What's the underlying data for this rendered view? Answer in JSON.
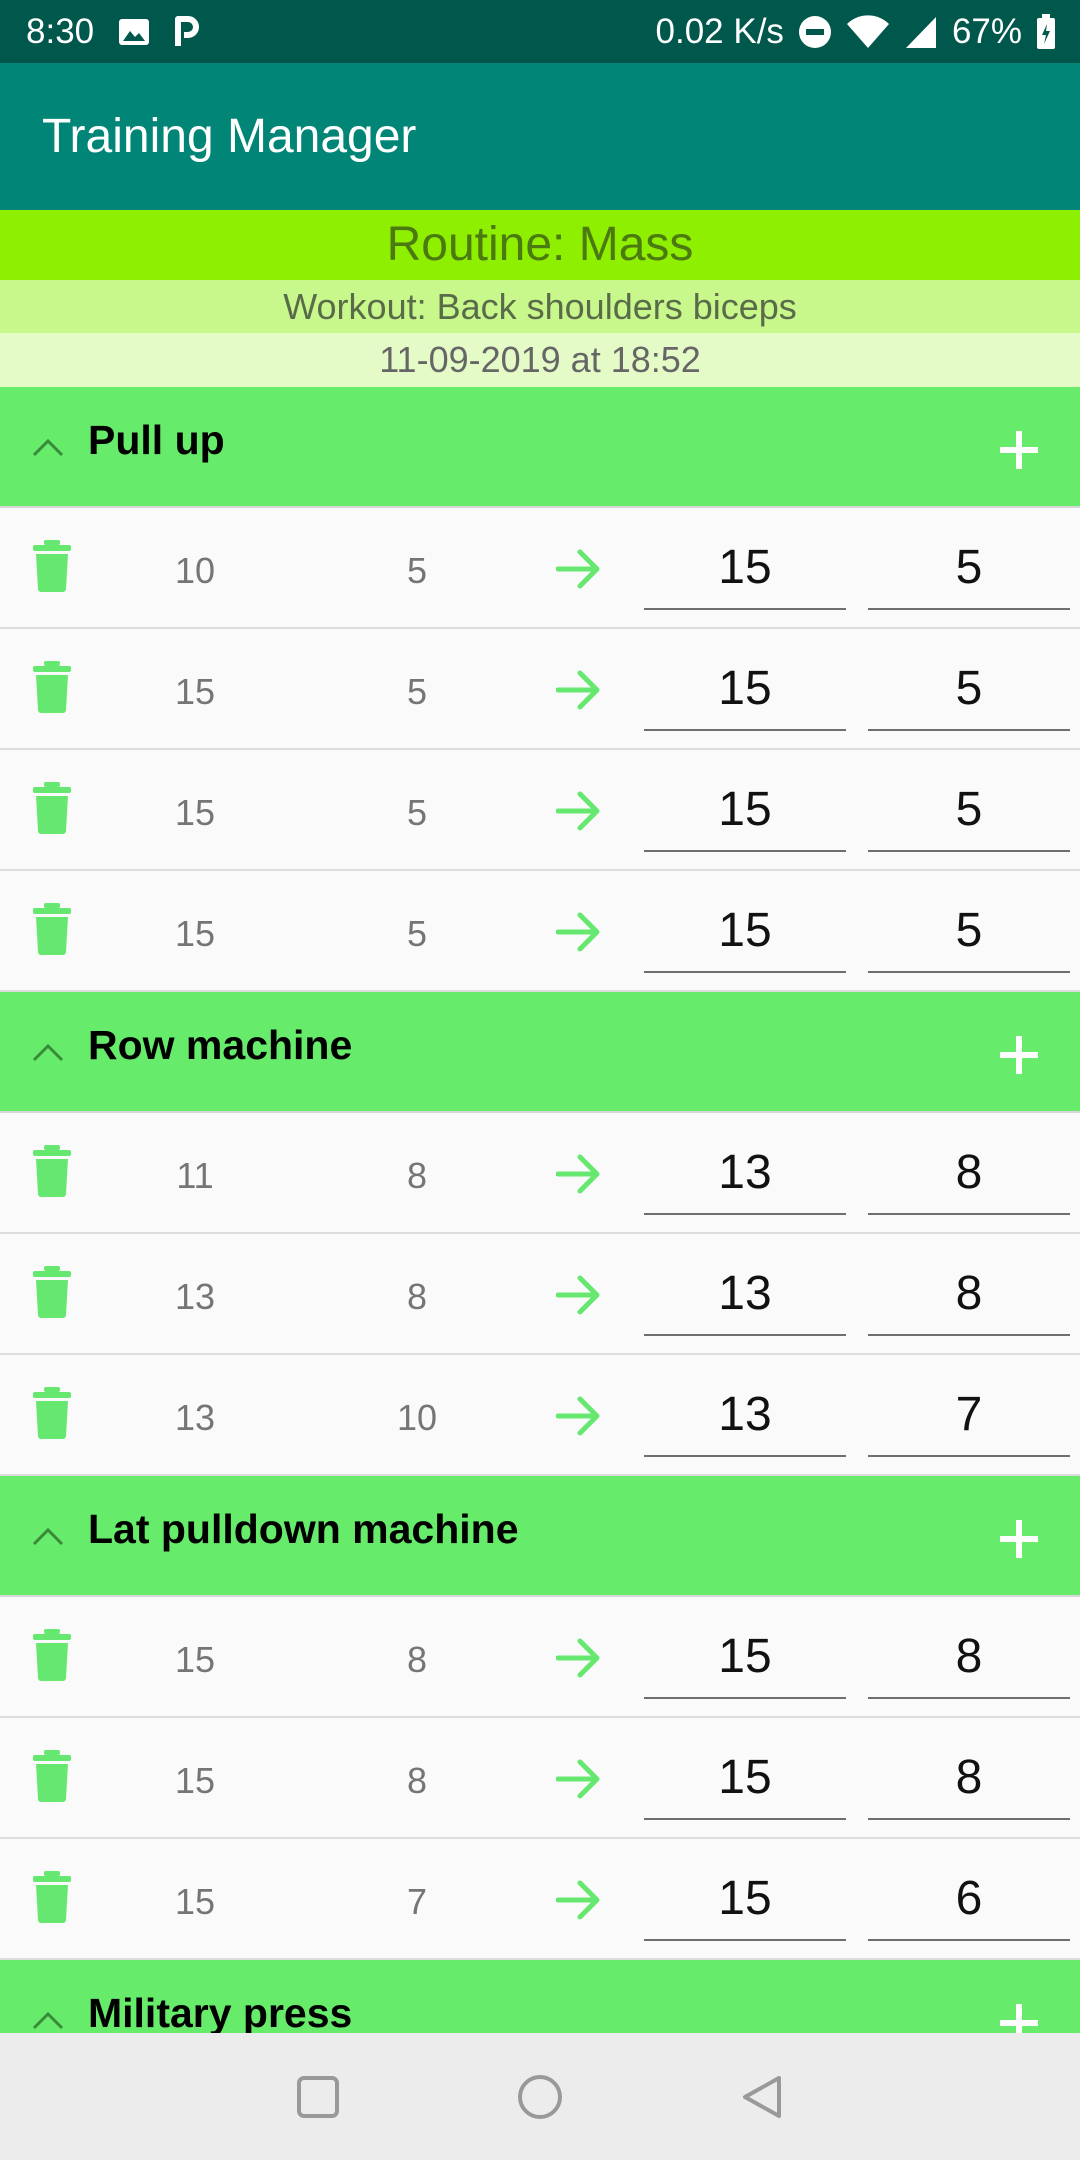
{
  "status_bar": {
    "time": "8:30",
    "speed": "0.02 K/s",
    "battery": "67%",
    "icons_left": [
      "image-icon",
      "parking-icon"
    ],
    "icons_right": [
      "dnd-icon",
      "wifi-icon",
      "signal-icon",
      "battery-icon"
    ]
  },
  "app": {
    "title": "Training Manager"
  },
  "routine": "Routine: Mass",
  "workout": "Workout: Back shoulders biceps",
  "date": "11-09-2019 at 18:52",
  "colors": {
    "header_green": "#66eb6a",
    "accent_green": "#66e870",
    "appbar": "#008577",
    "statusbar": "#00574b"
  },
  "exercises": [
    {
      "name": "Pull up",
      "sets": [
        {
          "prev_weight": "10",
          "prev_reps": "5",
          "weight": "15",
          "reps": "5"
        },
        {
          "prev_weight": "15",
          "prev_reps": "5",
          "weight": "15",
          "reps": "5"
        },
        {
          "prev_weight": "15",
          "prev_reps": "5",
          "weight": "15",
          "reps": "5"
        },
        {
          "prev_weight": "15",
          "prev_reps": "5",
          "weight": "15",
          "reps": "5"
        }
      ]
    },
    {
      "name": "Row machine",
      "sets": [
        {
          "prev_weight": "11",
          "prev_reps": "8",
          "weight": "13",
          "reps": "8"
        },
        {
          "prev_weight": "13",
          "prev_reps": "8",
          "weight": "13",
          "reps": "8"
        },
        {
          "prev_weight": "13",
          "prev_reps": "10",
          "weight": "13",
          "reps": "7"
        }
      ]
    },
    {
      "name": "Lat pulldown machine",
      "sets": [
        {
          "prev_weight": "15",
          "prev_reps": "8",
          "weight": "15",
          "reps": "8"
        },
        {
          "prev_weight": "15",
          "prev_reps": "8",
          "weight": "15",
          "reps": "8"
        },
        {
          "prev_weight": "15",
          "prev_reps": "7",
          "weight": "15",
          "reps": "6"
        }
      ]
    },
    {
      "name": "Military press",
      "sets": []
    }
  ]
}
